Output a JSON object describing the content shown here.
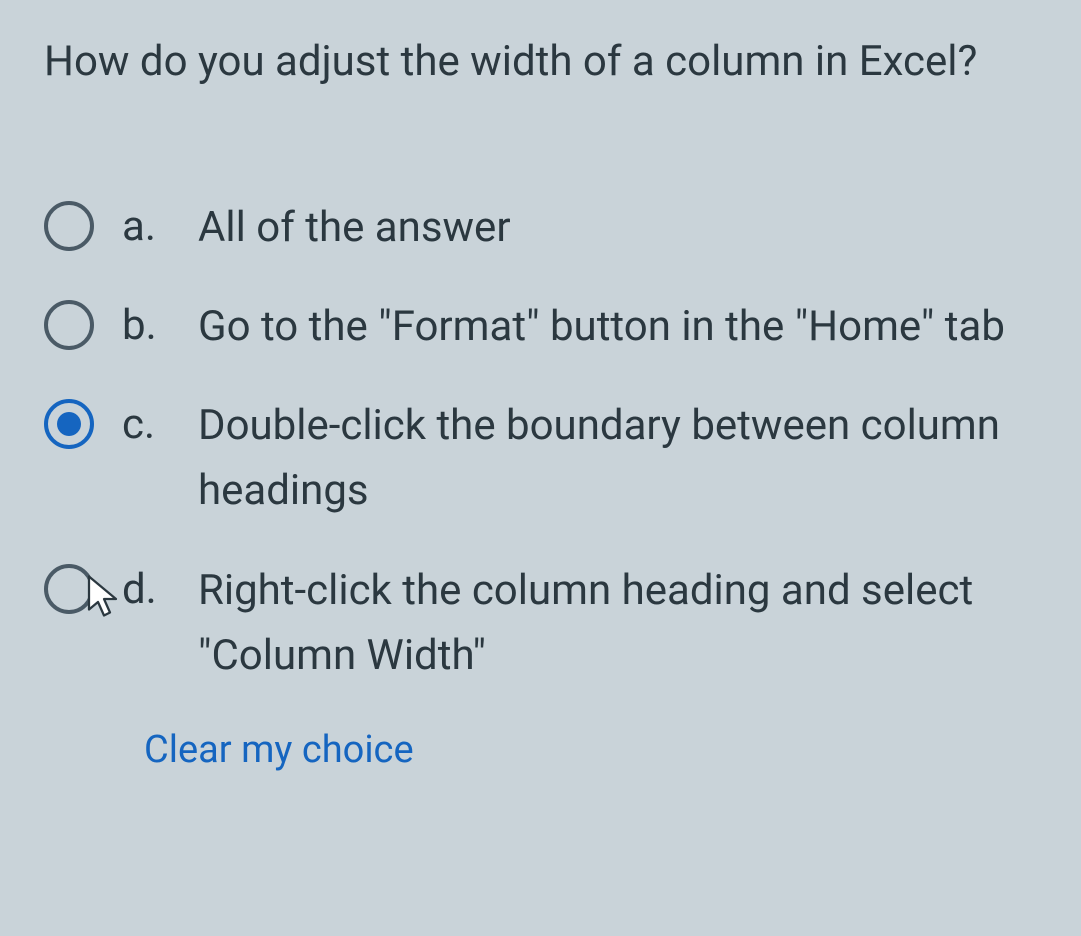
{
  "question": "How do you adjust the width of a column in Excel?",
  "options": [
    {
      "letter": "a.",
      "text": "All of the answer",
      "selected": false
    },
    {
      "letter": "b.",
      "text": "Go to the \"Format\" button in the \"Home\" tab",
      "selected": false
    },
    {
      "letter": "c.",
      "text": "Double-click the boundary between column headings",
      "selected": true
    },
    {
      "letter": "d.",
      "text": "Right-click the column heading and select \"Column Width\"",
      "selected": false
    }
  ],
  "clear_label": "Clear my choice"
}
